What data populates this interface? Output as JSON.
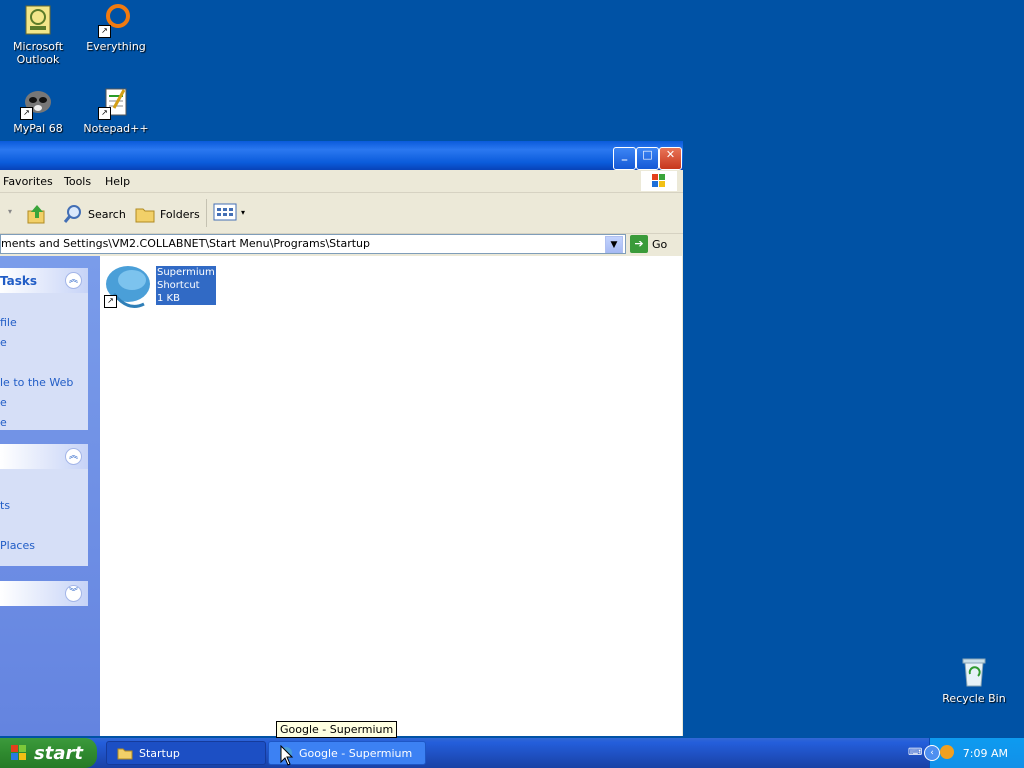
{
  "desktop": {
    "icons": [
      {
        "label": "Microsoft\nOutlook",
        "icon": "outlook-icon"
      },
      {
        "label": "Everything",
        "icon": "everything-icon"
      },
      {
        "label": "MyPal 68",
        "icon": "mypal-icon"
      },
      {
        "label": "Notepad++",
        "icon": "notepadpp-icon"
      },
      {
        "label": "Recycle Bin",
        "icon": "recycle-bin-icon"
      }
    ]
  },
  "explorer": {
    "menu": [
      "Favorites",
      "Tools",
      "Help"
    ],
    "toolbar": {
      "search": "Search",
      "folders": "Folders"
    },
    "address": "ments and Settings\\VM2.COLLABNET\\Start Menu\\Programs\\Startup",
    "go": "Go",
    "taskpane": {
      "panel1": {
        "title": "Tasks",
        "links": [
          "file",
          "e",
          "le to the Web",
          "e",
          "e"
        ]
      },
      "panel2": {
        "title": "",
        "links": [
          "ts",
          "",
          "Places"
        ]
      },
      "panel3": {
        "title": ""
      }
    },
    "file": {
      "name": "Supermium",
      "type": "Shortcut",
      "size": "1 KB"
    }
  },
  "tooltip": "Google - Supermium",
  "taskbar": {
    "start": "start",
    "tasks": [
      {
        "label": "Startup",
        "active": false
      },
      {
        "label": "Google - Supermium",
        "active": true
      }
    ],
    "clock": "7:09 AM"
  }
}
